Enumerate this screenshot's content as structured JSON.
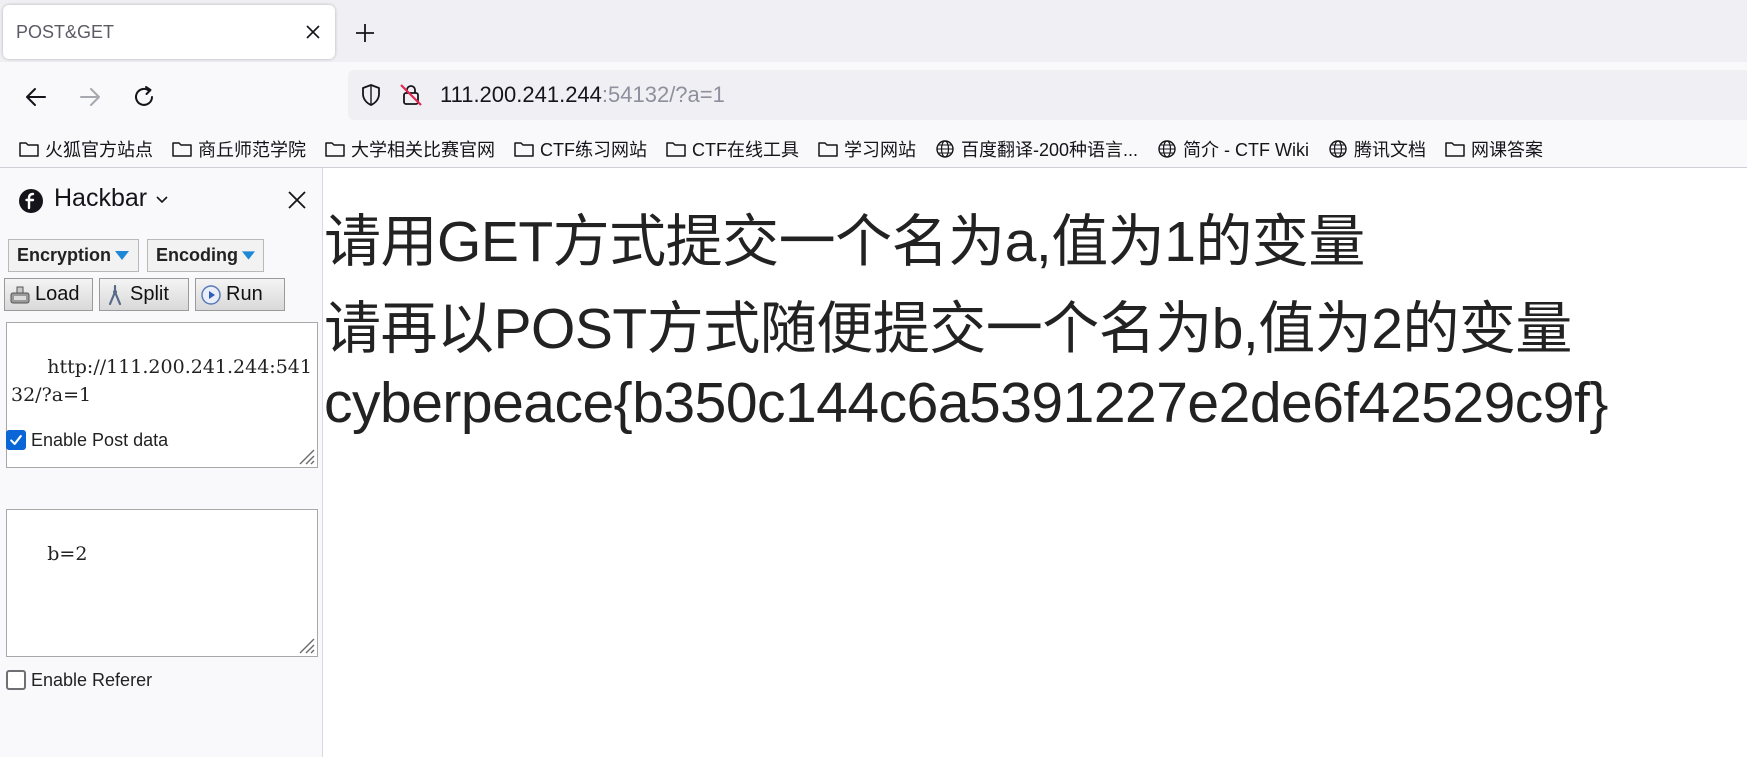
{
  "browser": {
    "tab": {
      "title": "POST&GET"
    },
    "url": {
      "host": "111.200.241.244",
      "rest": ":54132/?a=1"
    },
    "bookmarks": [
      {
        "label": "火狐官方站点",
        "icon": "folder-icon"
      },
      {
        "label": "商丘师范学院",
        "icon": "folder-icon"
      },
      {
        "label": "大学相关比赛官网",
        "icon": "folder-icon"
      },
      {
        "label": "CTF练习网站",
        "icon": "folder-icon"
      },
      {
        "label": "CTF在线工具",
        "icon": "folder-icon"
      },
      {
        "label": "学习网站",
        "icon": "folder-icon"
      },
      {
        "label": "百度翻译-200种语言...",
        "icon": "globe-icon"
      },
      {
        "label": "简介 - CTF Wiki",
        "icon": "globe-icon"
      },
      {
        "label": "腾讯文档",
        "icon": "globe-icon"
      },
      {
        "label": "网课答案",
        "icon": "folder-icon"
      }
    ]
  },
  "hackbar": {
    "title": "Hackbar",
    "encryption_label": "Encryption",
    "encoding_label": "Encoding",
    "load_label": "Load",
    "split_label": "Split",
    "run_label": "Run",
    "url_value": "http://111.200.241.244:54132/?a=1",
    "enable_post_label": "Enable Post data",
    "enable_post_checked": true,
    "post_value": "b=2",
    "enable_referer_label": "Enable Referer",
    "enable_referer_checked": false
  },
  "page": {
    "line1": "请用GET方式提交一个名为a,值为1的变量",
    "line2": "请再以POST方式随便提交一个名为b,值为2的变量",
    "line3": "cyberpeace{b350c144c6a5391227e2de6f42529c9f}"
  },
  "colors": {
    "accent": "#0a66d6",
    "dropdown_arrow": "#1e88d6"
  }
}
